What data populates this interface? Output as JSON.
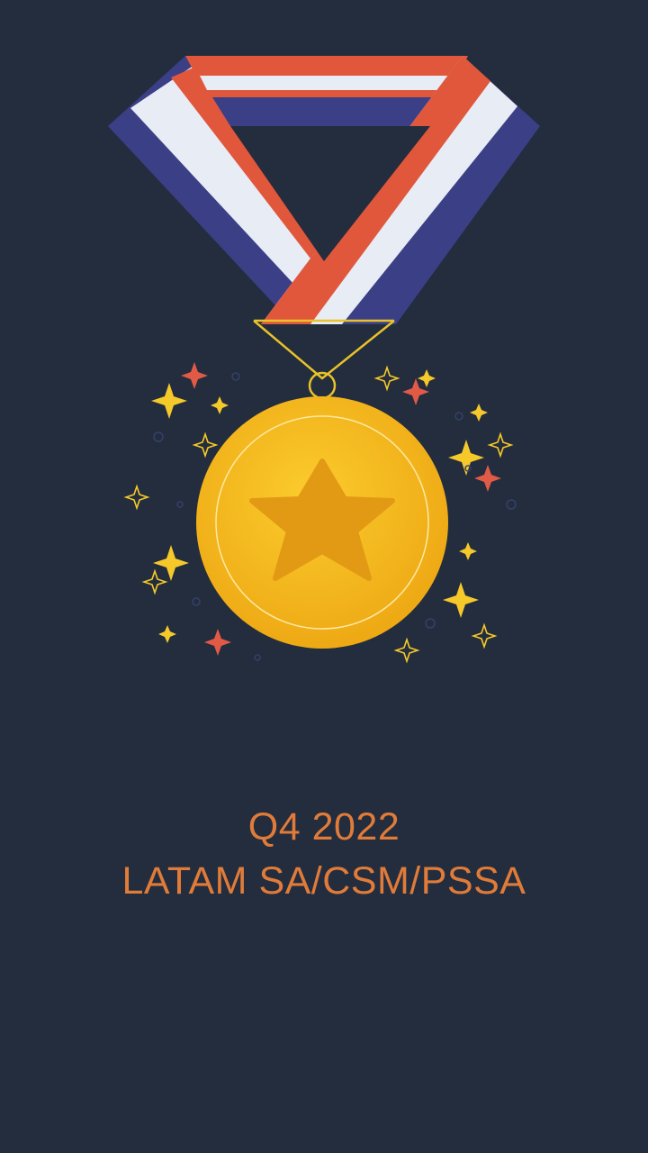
{
  "caption": {
    "line1": "Q4 2022",
    "line2": "LATAM SA/CSM/PSSA"
  },
  "illustration": {
    "subject": "medal-with-ribbon",
    "medal_icon": "star-icon",
    "colors": {
      "background": "#232d3d",
      "ribbon_red": "#e0573c",
      "ribbon_white": "#e8ecf5",
      "ribbon_blue": "#3b3f86",
      "medal_gold": "#f3b71a",
      "star_gold": "#e29a14",
      "sparkle_yellow": "#f6c92a",
      "sparkle_red": "#e15a46",
      "caption_orange": "#e07b39"
    }
  }
}
